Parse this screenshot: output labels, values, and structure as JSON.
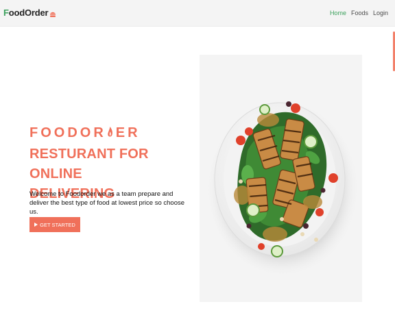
{
  "navbar": {
    "brand_initial": "F",
    "brand_rest": "oodOrder",
    "links": [
      {
        "label": "Home",
        "active": true
      },
      {
        "label": "Foods",
        "active": false
      },
      {
        "label": "Login",
        "active": false
      }
    ]
  },
  "hero": {
    "brand_part1": "FOODOR",
    "brand_part2": "ER",
    "title_line1": "RESTURANT FOR ONLINE",
    "title_line2": "DELIVERING",
    "description": "Welcome to Foodorder we as a team prepare and deliver the best type of food at lowest price so choose us.",
    "cta_label": "GET STARTED"
  },
  "colors": {
    "accent": "#f0705a",
    "brand_green": "#3aa05b",
    "active_link": "#3aa05b"
  },
  "icons": {
    "brand": "hamburger-icon",
    "hero_brand": "flame-icon",
    "cta": "play-icon"
  }
}
